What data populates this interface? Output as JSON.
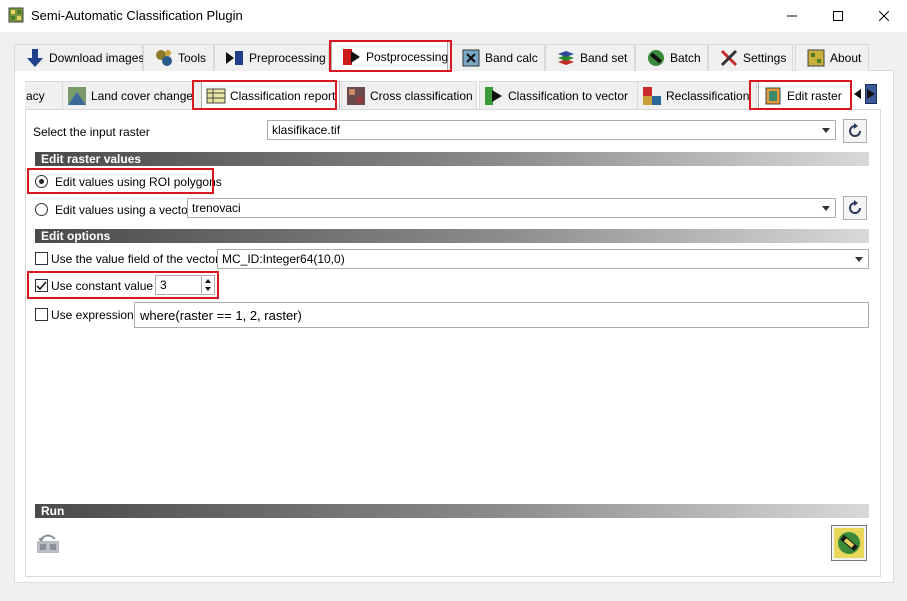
{
  "window": {
    "title": "Semi-Automatic Classification Plugin",
    "app_icon": "scp-plugin-icon",
    "controls": [
      "minimize-icon",
      "maximize-icon",
      "close-icon"
    ]
  },
  "main_tabs": [
    {
      "label": "Download images",
      "icon": "download-arrow-icon"
    },
    {
      "label": "Tools",
      "icon": "tools-icon"
    },
    {
      "label": "Preprocessing",
      "icon": "preprocessing-icon"
    },
    {
      "label": "Postprocessing",
      "icon": "postprocessing-icon"
    },
    {
      "label": "Band calc",
      "icon": "band-calc-icon"
    },
    {
      "label": "Band set",
      "icon": "band-set-icon"
    },
    {
      "label": "Batch",
      "icon": "batch-icon"
    },
    {
      "label": "Settings",
      "icon": "settings-icon"
    },
    {
      "label": "About",
      "icon": "about-icon"
    }
  ],
  "active_main_tab": "Postprocessing",
  "sub_tabs": [
    {
      "label": "acy",
      "icon": ""
    },
    {
      "label": "Land cover change",
      "icon": "land-cover-change-icon"
    },
    {
      "label": "Classification report",
      "icon": "classification-report-icon"
    },
    {
      "label": "Cross classification",
      "icon": "cross-classification-icon"
    },
    {
      "label": "Classification to vector",
      "icon": "classification-to-vector-icon"
    },
    {
      "label": "Reclassification",
      "icon": "reclassification-icon"
    },
    {
      "label": "Edit raster",
      "icon": "edit-raster-icon"
    }
  ],
  "active_sub_tab": "Edit raster",
  "input_raster": {
    "label": "Select the input raster",
    "value": "klasifikace.tif"
  },
  "sections": {
    "edit_values": "Edit raster values",
    "edit_options": "Edit options",
    "run": "Run"
  },
  "edit_values": {
    "roi_label": "Edit values using ROI polygons",
    "roi_checked": true,
    "vector_label": "Edit values using a vector",
    "vector_checked": false,
    "vector_value": "trenovaci"
  },
  "edit_options": {
    "value_field_label": "Use the value field of the vector",
    "value_field_checked": false,
    "value_field_value": "MC_ID:Integer64(10,0)",
    "constant_label": "Use constant value",
    "constant_checked": true,
    "constant_value": "3",
    "expression_label": "Use expression",
    "expression_checked": false,
    "expression_value": "where(raster == 1, 2, raster)"
  },
  "run": {
    "undo_icon": "undo-edit-icon",
    "run_icon": "run-icon"
  },
  "colors": {
    "highlight": "#d7191f",
    "section_header_dark": "#4a4a4a"
  }
}
